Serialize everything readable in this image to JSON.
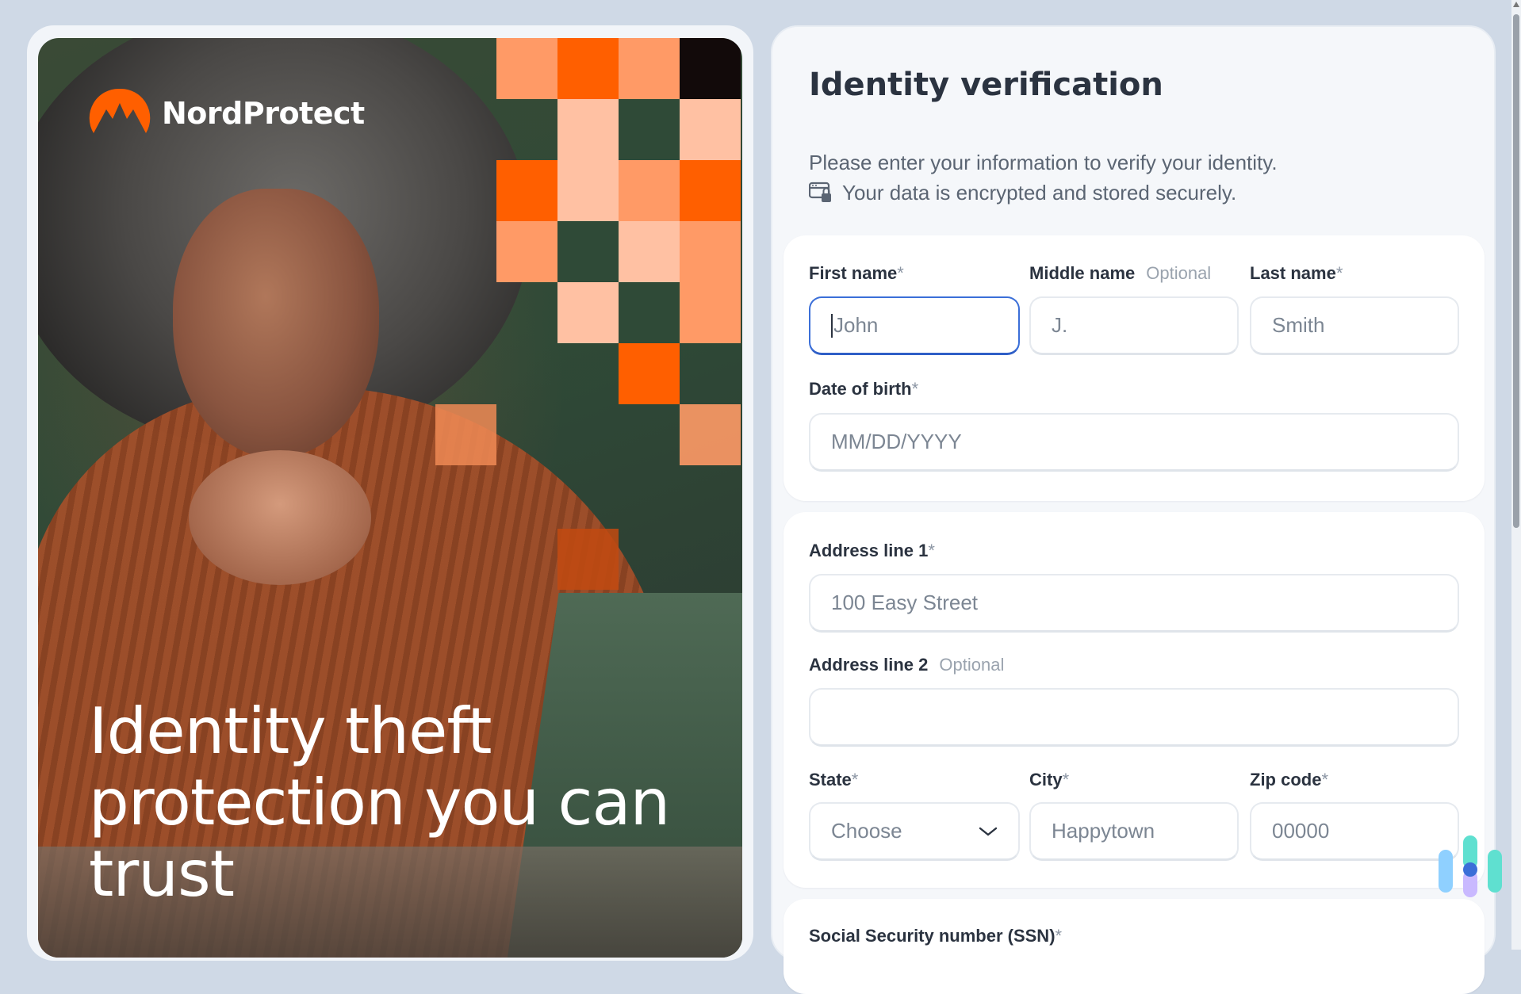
{
  "hero": {
    "brand": "NordProtect",
    "headline": "Identity theft protection you can trust",
    "colors": {
      "orange": "#ff5f00",
      "light_orange": "#ff9a66",
      "peach": "#ffc1a3",
      "green": "#2f4a37"
    }
  },
  "form": {
    "title": "Identity verification",
    "intro_line1": "Please enter your information to verify your identity.",
    "intro_line2": "Your data is encrypted and stored securely.",
    "required_mark": "*",
    "optional_label": "Optional",
    "first_name": {
      "label": "First name",
      "value": "John"
    },
    "middle_name": {
      "label": "Middle name",
      "value": "J."
    },
    "last_name": {
      "label": "Last name",
      "value": "Smith"
    },
    "dob": {
      "label": "Date of birth",
      "placeholder": "MM/DD/YYYY"
    },
    "address1": {
      "label": "Address line 1",
      "value": "100 Easy Street"
    },
    "address2": {
      "label": "Address line 2",
      "value": ""
    },
    "state": {
      "label": "State",
      "value": "Choose"
    },
    "city": {
      "label": "City",
      "value": "Happytown"
    },
    "zip": {
      "label": "Zip code",
      "value": "00000"
    },
    "ssn": {
      "label": "Social Security number (SSN)"
    }
  },
  "icons": [
    "nordprotect-logo-icon",
    "lock-window-icon",
    "chevron-down-icon",
    "brand-badge-icon"
  ],
  "accent_color": "#3b6fd8"
}
